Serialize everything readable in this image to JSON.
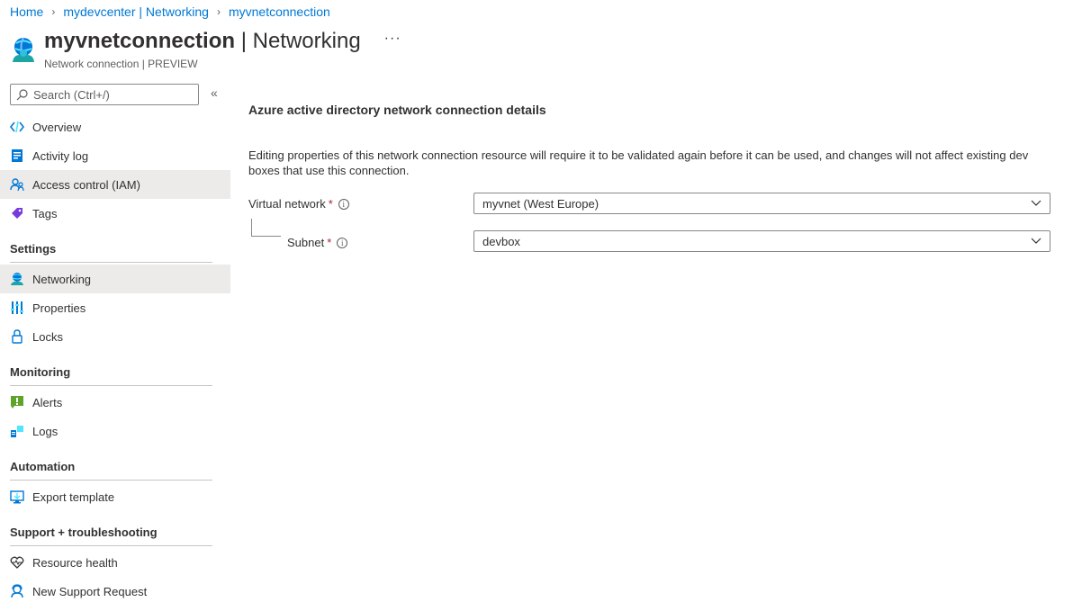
{
  "breadcrumb": {
    "items": [
      "Home",
      "mydevcenter | Networking",
      "myvnetconnection"
    ]
  },
  "header": {
    "resource_name": "myvnetconnection",
    "page_name": " | Networking",
    "subtitle": "Network connection | PREVIEW",
    "more_label": "···"
  },
  "sidebar": {
    "search_placeholder": "Search (Ctrl+/)",
    "collapse_label": "«",
    "items_top": [
      {
        "label": "Overview",
        "icon": "overview-icon"
      },
      {
        "label": "Activity log",
        "icon": "activity-log-icon"
      },
      {
        "label": "Access control (IAM)",
        "icon": "iam-icon"
      },
      {
        "label": "Tags",
        "icon": "tag-icon"
      }
    ],
    "sections": {
      "settings": "Settings",
      "monitoring": "Monitoring",
      "automation": "Automation",
      "support": "Support + troubleshooting"
    },
    "settings_items": [
      {
        "label": "Networking",
        "icon": "networking-icon"
      },
      {
        "label": "Properties",
        "icon": "properties-icon"
      },
      {
        "label": "Locks",
        "icon": "lock-icon"
      }
    ],
    "monitoring_items": [
      {
        "label": "Alerts",
        "icon": "alert-icon"
      },
      {
        "label": "Logs",
        "icon": "logs-icon"
      }
    ],
    "automation_items": [
      {
        "label": "Export template",
        "icon": "export-template-icon"
      }
    ],
    "support_items": [
      {
        "label": "Resource health",
        "icon": "heart-icon"
      },
      {
        "label": "New Support Request",
        "icon": "support-icon"
      }
    ]
  },
  "main": {
    "heading": "Azure active directory network connection details",
    "description": "Editing properties of this network connection resource will require it to be validated again before it can be used, and changes will not affect existing dev boxes that use this connection.",
    "virtual_network": {
      "label": "Virtual network",
      "required": "*",
      "value": "myvnet (West Europe)"
    },
    "subnet": {
      "label": "Subnet",
      "required": "*",
      "value": "devbox"
    },
    "info_glyph": "i"
  },
  "colors": {
    "link": "#0078d4",
    "active_bg": "#edebe9",
    "required": "#a4262c"
  }
}
